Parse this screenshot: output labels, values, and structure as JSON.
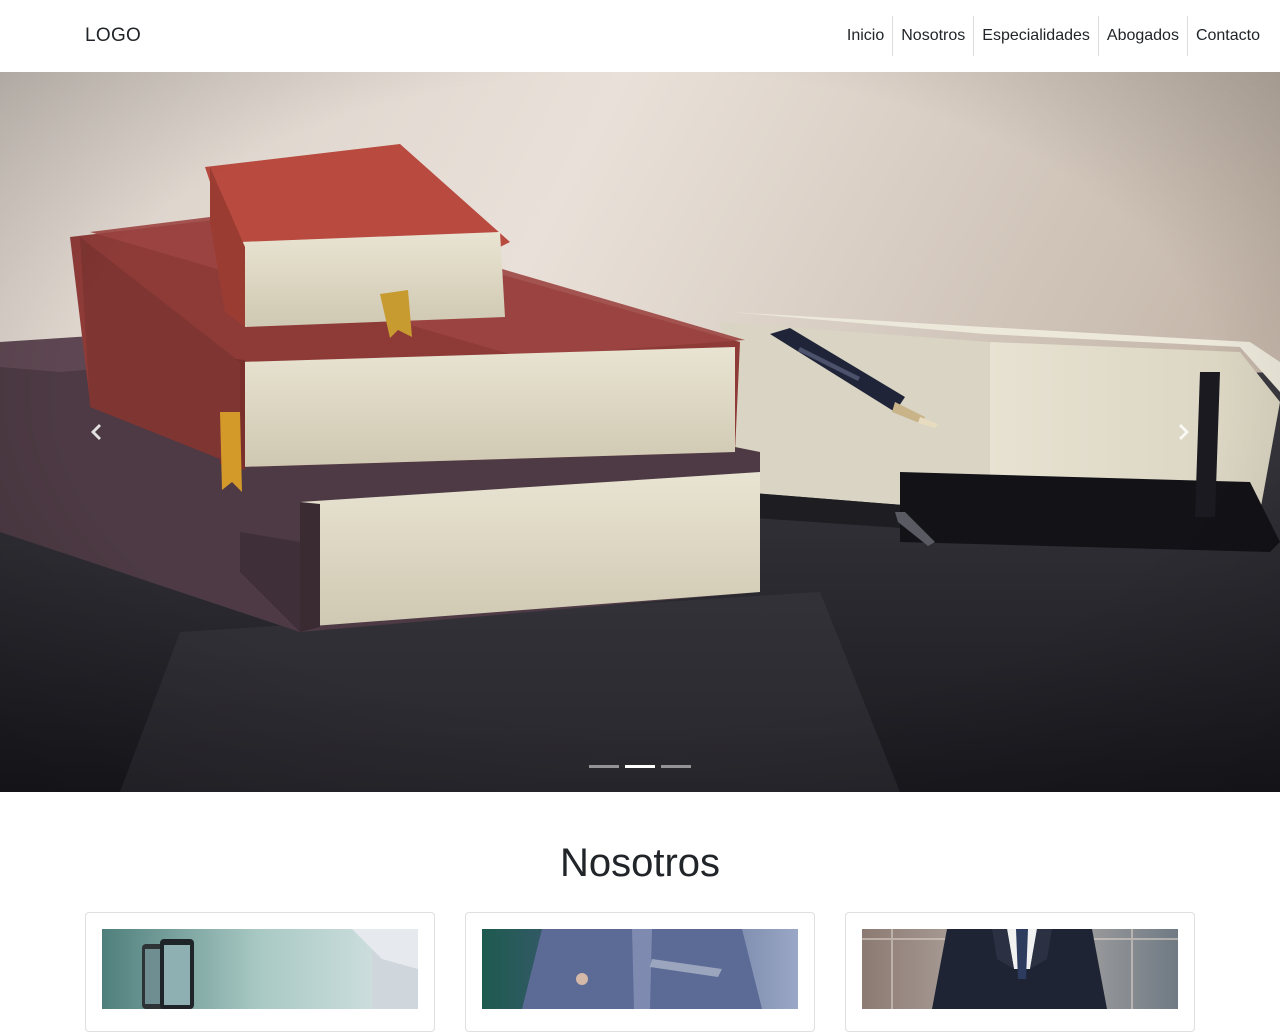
{
  "header": {
    "logo": "LOGO",
    "nav": [
      {
        "label": "Inicio"
      },
      {
        "label": "Nosotros"
      },
      {
        "label": "Especialidades"
      },
      {
        "label": "Abogados"
      },
      {
        "label": "Contacto"
      }
    ]
  },
  "hero": {
    "slides_count": 3,
    "active_slide": 2,
    "image": "books-and-pen-on-desk",
    "prev_icon": "chevron-left-icon",
    "next_icon": "chevron-right-icon"
  },
  "about": {
    "title": "Nosotros",
    "cards": [
      {
        "image": "smartphones-photo"
      },
      {
        "image": "person-in-shirt-photo"
      },
      {
        "image": "businessman-in-suit-photo"
      }
    ]
  },
  "colors": {
    "text": "#212529",
    "nav_divider": "#dcdcdc",
    "card_border": "rgba(0,0,0,0.125)"
  }
}
